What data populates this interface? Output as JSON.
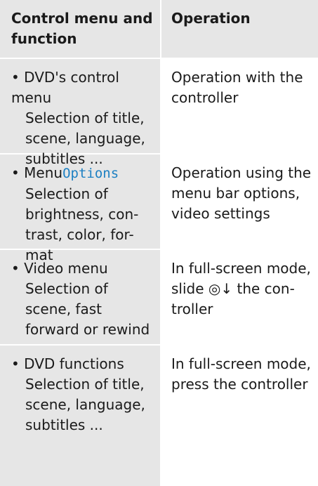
{
  "header": {
    "col1": "Control menu and function",
    "col2": "Operation"
  },
  "rows": [
    {
      "function_title": "• DVD's control menu",
      "function_detail": "Selection of title, scene, language, subtitles ...",
      "operation": "Operation with the controller"
    },
    {
      "function_prefix": "• Menu",
      "function_keyword": "Options",
      "function_detail": "Selection of brightness, con-trast, color, for-mat",
      "operation": "Operation using the menu bar options, video settings"
    },
    {
      "function_title": "• Video menu",
      "function_detail": "Selection of scene, fast forward or rewind",
      "operation_prefix": "In full-screen mode, slide",
      "operation_symbol": "◎↓",
      "operation_suffix": "the con-troller"
    },
    {
      "function_title": "• DVD functions",
      "function_detail": "Selection of title, scene, language, subtitles ...",
      "operation": "In full-screen mode, press the controller"
    }
  ]
}
